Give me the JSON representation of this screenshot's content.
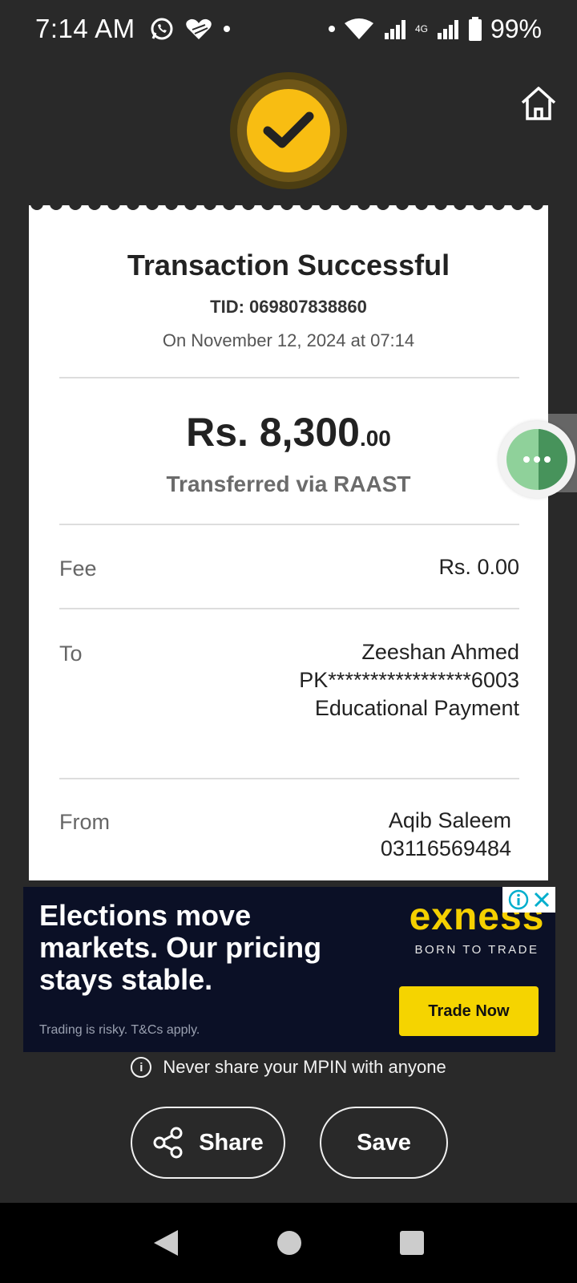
{
  "status_bar": {
    "time": "7:14 AM",
    "network": "4G",
    "battery": "99%",
    "icons": [
      "whatsapp-icon",
      "heart-icon",
      "wifi-icon",
      "signal-icon",
      "battery-icon"
    ]
  },
  "header": {
    "success_icon": "check-icon",
    "home_icon": "home-icon"
  },
  "receipt": {
    "title": "Transaction Successful",
    "tid": "TID: 069807838860",
    "date": "On November 12, 2024 at 07:14",
    "amount_main": "Rs. 8,300",
    "amount_cents": ".00",
    "method": "Transferred via RAAST",
    "fee": {
      "label": "Fee",
      "value": "Rs. 0.00"
    },
    "to": {
      "label": "To",
      "name": "Zeeshan Ahmed",
      "account": "PK*****************6003",
      "purpose": "Educational Payment"
    },
    "from": {
      "label": "From",
      "name": "Aqib Saleem",
      "phone": "03116569484"
    }
  },
  "ad": {
    "headline": "Elections move markets. Our pricing stays stable.",
    "disclaimer": "Trading is risky. T&Cs apply.",
    "brand": "exness",
    "tagline": "BORN TO TRADE",
    "cta": "Trade Now"
  },
  "warning": "Never share your MPIN with anyone",
  "actions": {
    "share_label": "Share",
    "save_label": "Save"
  },
  "colors": {
    "background": "#292929",
    "accent": "#f8bd12",
    "card": "#ffffff",
    "fab": "#8fd19a",
    "ad_bg": "#0b1026",
    "ad_brand": "#f5d000"
  }
}
